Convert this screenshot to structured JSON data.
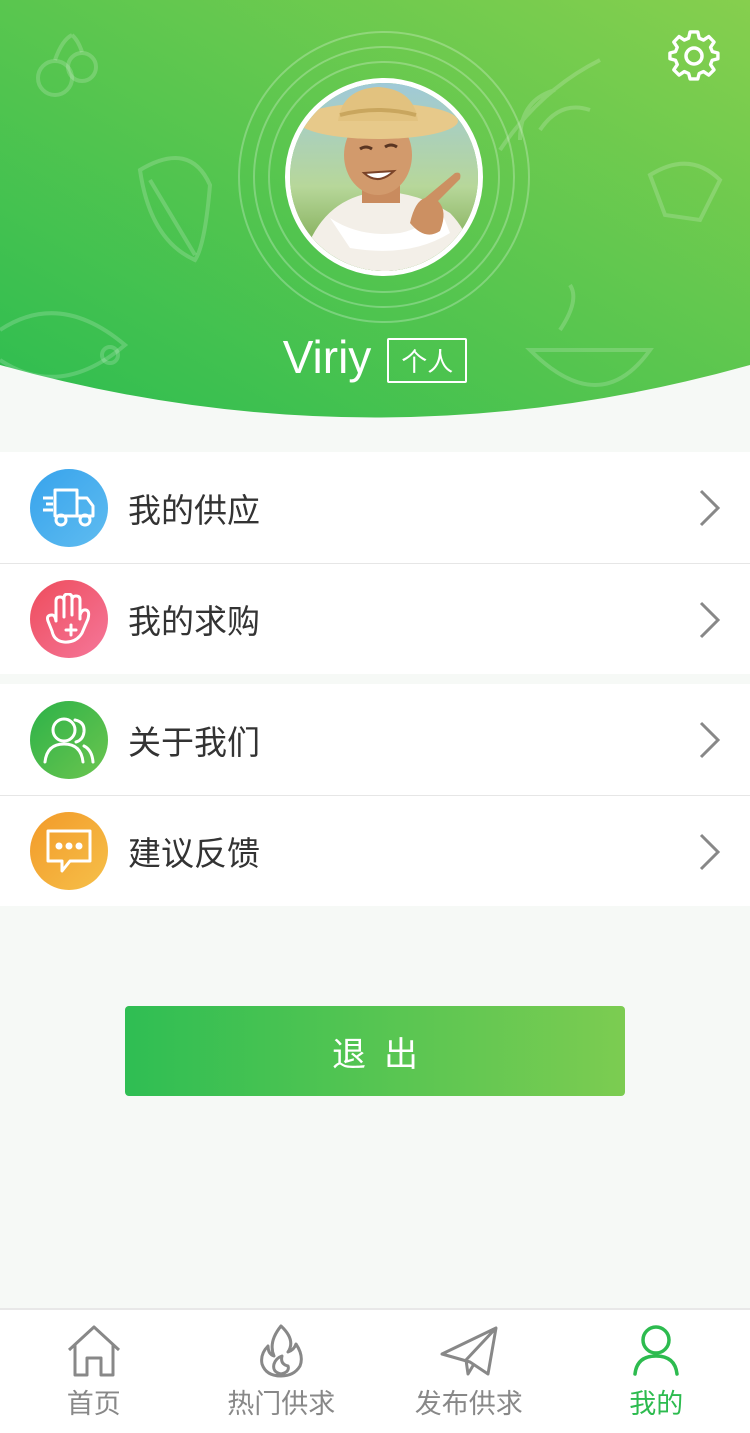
{
  "header": {
    "username": "Viriy",
    "user_tag": "个人"
  },
  "menu": {
    "group1": [
      {
        "label": "我的供应",
        "icon": "truck-icon",
        "color": "#3e9ee8"
      },
      {
        "label": "我的求购",
        "icon": "hand-icon",
        "color": "#ef5069"
      }
    ],
    "group2": [
      {
        "label": "关于我们",
        "icon": "users-icon",
        "color": "#3bb54a"
      },
      {
        "label": "建议反馈",
        "icon": "chat-icon",
        "color": "#f0a22c"
      }
    ]
  },
  "logout_label": "退出",
  "tabbar": [
    {
      "label": "首页",
      "icon": "home-icon",
      "active": false
    },
    {
      "label": "热门供求",
      "icon": "flame-icon",
      "active": false
    },
    {
      "label": "发布供求",
      "icon": "paper-plane-icon",
      "active": false
    },
    {
      "label": "我的",
      "icon": "person-icon",
      "active": true
    }
  ],
  "colors": {
    "accent": "#2dbb4f",
    "header_start": "#2dbd50",
    "header_end": "#86cf4e"
  }
}
